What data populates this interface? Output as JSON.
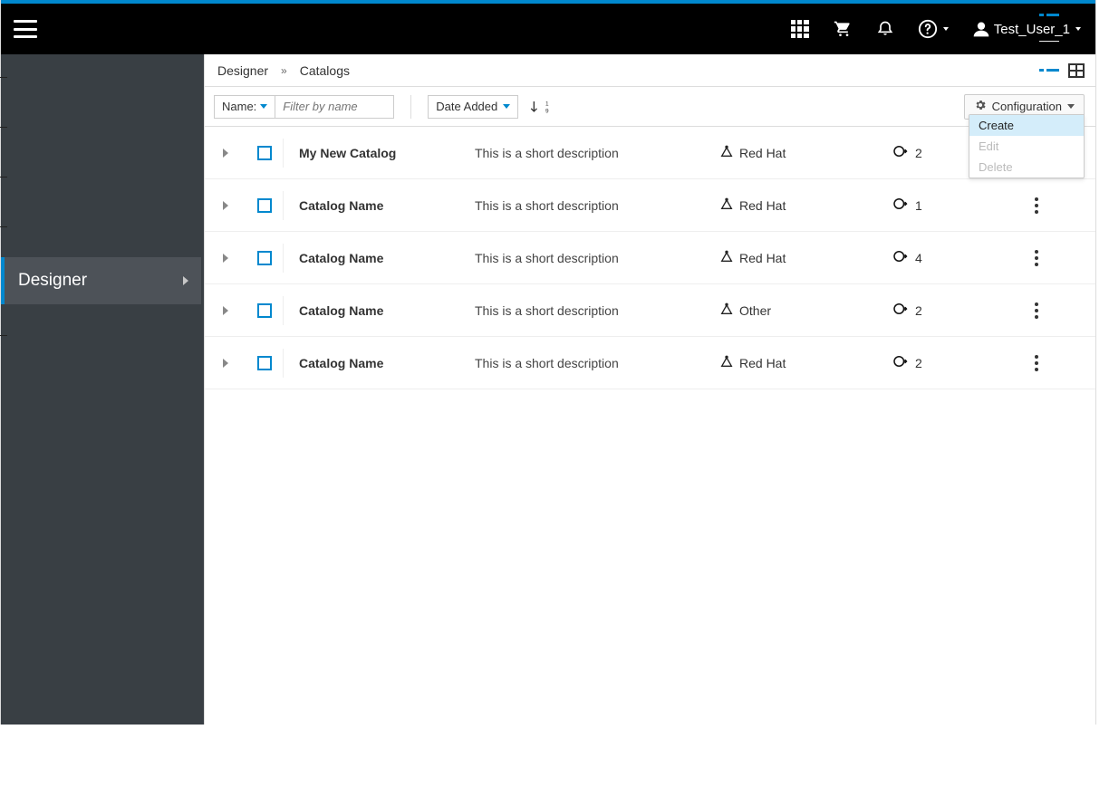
{
  "header": {
    "user_name": "Test_User_1"
  },
  "sidebar": {
    "active_label": "Designer"
  },
  "breadcrumb": {
    "items": [
      "Designer",
      "Catalogs"
    ]
  },
  "toolbar": {
    "filter_label": "Name:",
    "filter_placeholder": "Filter by name",
    "sort_label": "Date Added",
    "config_label": "Configuration",
    "config_menu": {
      "create": "Create",
      "edit": "Edit",
      "delete": "Delete"
    }
  },
  "rows": [
    {
      "name": "My New Catalog",
      "desc": "This is a short description",
      "platform": "Red Hat",
      "count": "2",
      "kebab": false
    },
    {
      "name": "Catalog Name",
      "desc": "This is a short description",
      "platform": "Red Hat",
      "count": "1",
      "kebab": true
    },
    {
      "name": "Catalog Name",
      "desc": "This is a short description",
      "platform": "Red Hat",
      "count": "4",
      "kebab": true
    },
    {
      "name": "Catalog Name",
      "desc": "This is a short description",
      "platform": "Other",
      "count": "2",
      "kebab": true
    },
    {
      "name": "Catalog Name",
      "desc": "This is a short description",
      "platform": "Red Hat",
      "count": "2",
      "kebab": true
    }
  ]
}
